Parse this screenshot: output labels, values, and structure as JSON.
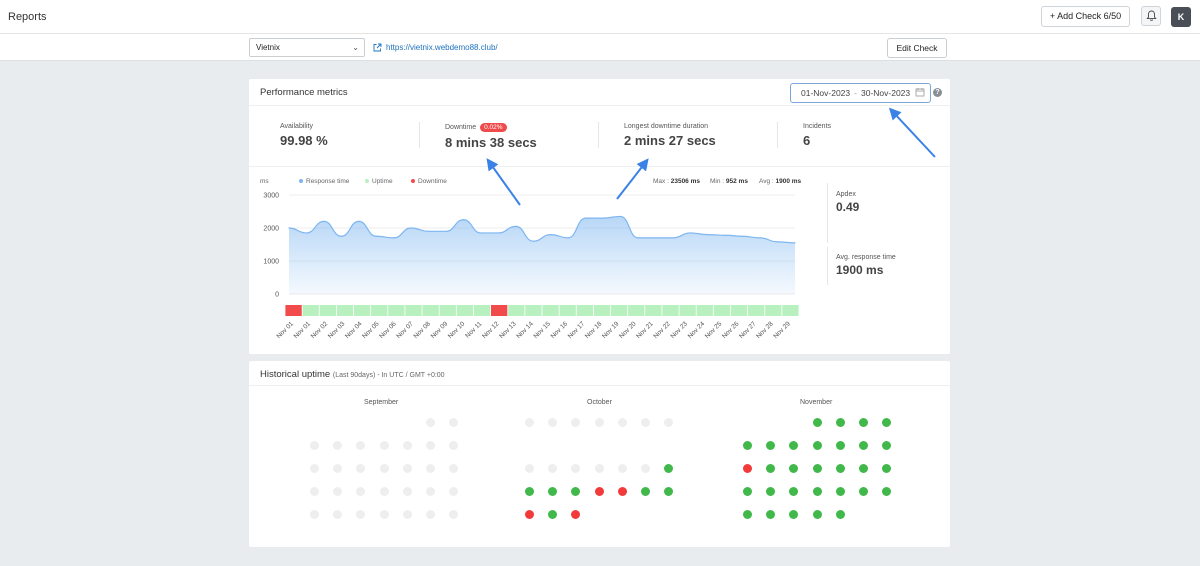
{
  "topbar": {
    "title": "Reports",
    "add_check_label": "+ Add Check 6/50",
    "avatar_initial": "K"
  },
  "subbar": {
    "site_name": "Vietnix",
    "site_url": "https://vietnix.webdemo88.club/",
    "edit_check_label": "Edit Check"
  },
  "performance": {
    "title": "Performance metrics",
    "date_from": "01-Nov-2023",
    "date_sep": "-",
    "date_to": "30-Nov-2023",
    "help": "?",
    "stats": {
      "availability_label": "Availability",
      "availability_value": "99.98 %",
      "downtime_label": "Downtime",
      "downtime_badge": "0.02%",
      "downtime_value": "8 mins 38 secs",
      "longest_label": "Longest downtime duration",
      "longest_value": "2 mins 27 secs",
      "incidents_label": "Incidents",
      "incidents_value": "6"
    },
    "legend": {
      "unit": "ms",
      "response_time": "Response time",
      "uptime": "Uptime",
      "downtime": "Downtime"
    },
    "summary": {
      "max_label": "Max :",
      "max_value": "23506 ms",
      "min_label": "Min :",
      "min_value": "952 ms",
      "avg_label": "Avg :",
      "avg_value": "1900 ms"
    },
    "apdex_label": "Apdex",
    "apdex_value": "0.49",
    "avg_response_label": "Avg. response time",
    "avg_response_value": "1900 ms",
    "colors": {
      "response": "#7db6f0",
      "uptime": "#b9f0c0",
      "downtime": "#f24b4b"
    }
  },
  "chart_data": {
    "type": "area",
    "ylabel": "ms",
    "ylim": [
      0,
      3000
    ],
    "yticks": [
      3000,
      2000,
      1000,
      0
    ],
    "categories": [
      "Nov 01",
      "Nov 01",
      "Nov 02",
      "Nov 03",
      "Nov 04",
      "Nov 05",
      "Nov 06",
      "Nov 07",
      "Nov 08",
      "Nov 09",
      "Nov 10",
      "Nov 11",
      "Nov 12",
      "Nov 13",
      "Nov 14",
      "Nov 15",
      "Nov 16",
      "Nov 17",
      "Nov 18",
      "Nov 19",
      "Nov 20",
      "Nov 21",
      "Nov 22",
      "Nov 23",
      "Nov 24",
      "Nov 25",
      "Nov 26",
      "Nov 27",
      "Nov 28",
      "Nov 29"
    ],
    "series": [
      {
        "name": "Response time",
        "values": [
          2000,
          1850,
          2200,
          1750,
          2200,
          1750,
          1700,
          2000,
          1900,
          1900,
          2250,
          1850,
          1850,
          2050,
          1600,
          1800,
          1700,
          2300,
          2300,
          2350,
          1700,
          1700,
          1700,
          1850,
          1800,
          1780,
          1750,
          1700,
          1580,
          1550
        ]
      }
    ],
    "status_strip": [
      "down",
      "up",
      "up",
      "up",
      "up",
      "up",
      "up",
      "up",
      "up",
      "up",
      "up",
      "up",
      "down",
      "up",
      "up",
      "up",
      "up",
      "up",
      "up",
      "up",
      "up",
      "up",
      "up",
      "up",
      "up",
      "up",
      "up",
      "up",
      "up",
      "up"
    ]
  },
  "historical": {
    "title": "Historical uptime",
    "subtitle": "(Last 90days) - In UTC / GMT +0:00",
    "months": [
      {
        "name": "September",
        "rows": [
          [
            "none",
            "none",
            "none",
            "none",
            "none",
            "empty",
            "empty"
          ],
          [
            "empty",
            "empty",
            "empty",
            "empty",
            "empty",
            "empty",
            "empty"
          ],
          [
            "empty",
            "empty",
            "empty",
            "empty",
            "empty",
            "empty",
            "empty"
          ],
          [
            "empty",
            "empty",
            "empty",
            "empty",
            "empty",
            "empty",
            "empty"
          ],
          [
            "empty",
            "empty",
            "empty",
            "empty",
            "empty",
            "empty",
            "empty"
          ]
        ]
      },
      {
        "name": "October",
        "rows": [
          [
            "empty",
            "empty",
            "empty",
            "empty",
            "empty",
            "empty",
            "empty"
          ],
          [
            "none",
            "none",
            "none",
            "none",
            "none",
            "none",
            "none"
          ],
          [
            "empty",
            "empty",
            "empty",
            "empty",
            "empty",
            "empty",
            "up"
          ],
          [
            "up",
            "up",
            "up",
            "down",
            "down",
            "up",
            "up"
          ],
          [
            "down",
            "up",
            "down",
            "none",
            "none",
            "none",
            "none"
          ]
        ]
      },
      {
        "name": "November",
        "rows": [
          [
            "none",
            "none",
            "none",
            "up",
            "up",
            "up",
            "up"
          ],
          [
            "up",
            "up",
            "up",
            "up",
            "up",
            "up",
            "up"
          ],
          [
            "down",
            "up",
            "up",
            "up",
            "up",
            "up",
            "up"
          ],
          [
            "up",
            "up",
            "up",
            "up",
            "up",
            "up",
            "up"
          ],
          [
            "up",
            "up",
            "up",
            "up",
            "up",
            "none",
            "none"
          ]
        ]
      }
    ]
  }
}
